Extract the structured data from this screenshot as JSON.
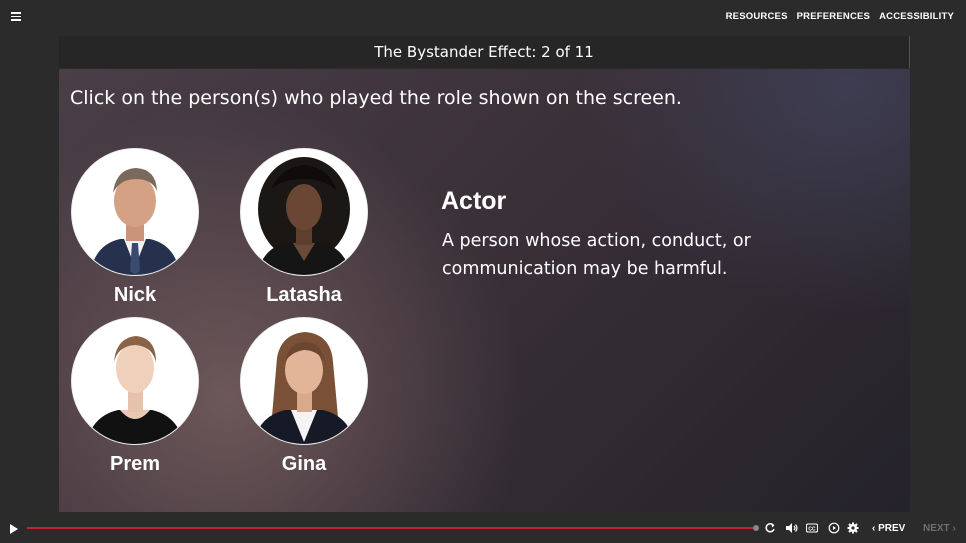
{
  "topnav": {
    "resources": "RESOURCES",
    "preferences": "PREFERENCES",
    "accessibility": "ACCESSIBILITY"
  },
  "slide": {
    "title": "The Bystander Effect: 2 of 11",
    "instruction": "Click on the person(s) who played the role shown on the screen.",
    "people": [
      {
        "name": "Nick"
      },
      {
        "name": "Latasha"
      },
      {
        "name": "Prem"
      },
      {
        "name": "Gina"
      }
    ],
    "role": {
      "title": "Actor",
      "description": "A person whose action, conduct, or communication may be harmful."
    }
  },
  "player": {
    "prev_label": "PREV",
    "next_label": "NEXT",
    "progress_fraction": 1.0,
    "accent_color": "#c8232c"
  }
}
